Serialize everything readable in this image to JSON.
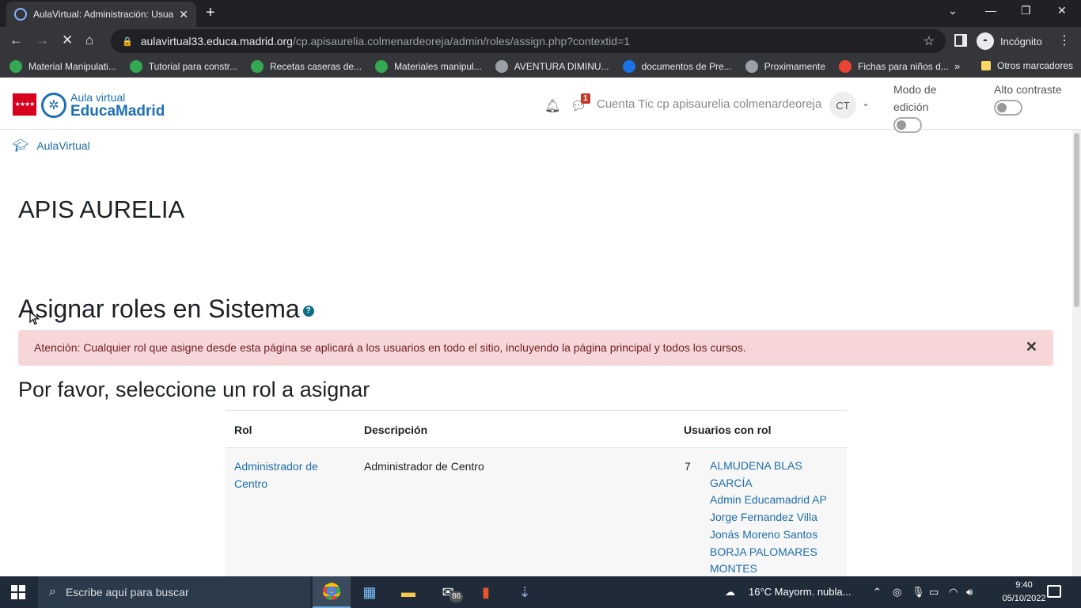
{
  "browser": {
    "tab_title": "AulaVirtual: Administración: Usuarios",
    "url_host": "aulavirtual33.educa.madrid.org",
    "url_path": "/cp.apisaurelia.colmenardeoreja/admin/roles/assign.php?contextid=1",
    "profile_label": "Incógnito",
    "bookmarks": [
      {
        "label": "Material Manipulati...",
        "color": "#34a853"
      },
      {
        "label": "Tutorial para constr...",
        "color": "#34a853"
      },
      {
        "label": "Recetas caseras de...",
        "color": "#34a853"
      },
      {
        "label": "Materiales manipul...",
        "color": "#34a853"
      },
      {
        "label": "AVENTURA DIMINU...",
        "color": "#9aa0a6"
      },
      {
        "label": "documentos de Pre...",
        "color": "#1a73e8"
      },
      {
        "label": "Proximamente",
        "color": "#9aa0a6"
      },
      {
        "label": "Fichas para niños d...",
        "color": "#ea4335"
      }
    ],
    "bookmarks_more": "»",
    "other_bookmarks": "Otros marcadores"
  },
  "header": {
    "logo_line1": "Aula virtual",
    "logo_line2": "EducaMadrid",
    "messages_badge": "1",
    "user_name": "Cuenta Tic cp apisaurelia colmenardeoreja",
    "user_initials": "CT",
    "edit_mode_label": "Modo de edición",
    "contrast_label": "Alto contraste"
  },
  "main": {
    "breadcrumb": "AulaVirtual",
    "site_name": "APIS AURELIA",
    "heading": "Asignar roles en Sistema",
    "alert_text": "Atención: Cualquier rol que asigne desde esta página se aplicará a los usuarios en todo el sitio, incluyendo la página principal y todos los cursos.",
    "subheading": "Por favor, seleccione un rol a asignar",
    "table": {
      "headers": [
        "Rol",
        "Descripción",
        "Usuarios con rol"
      ],
      "rows": [
        {
          "role": "Administrador de Centro",
          "description": "Administrador de Centro",
          "count": "7",
          "users": [
            "ALMUDENA BLAS GARCÍA",
            "Admin Educamadrid AP",
            "Jorge Fernandez Villa",
            "Jonás Moreno Santos",
            "BORJA PALOMARES MONTES"
          ]
        }
      ]
    }
  },
  "taskbar": {
    "search_placeholder": "Escribe aquí para buscar",
    "mail_badge": "86",
    "weather": "16°C  Mayorm. nubla...",
    "time": "9:40",
    "date": "05/10/2022"
  }
}
